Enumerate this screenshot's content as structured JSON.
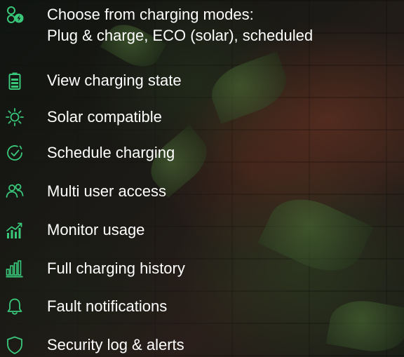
{
  "features": [
    {
      "icon": "charging-modes-icon",
      "label": "Choose from charging modes:",
      "sublabel": "Plug & charge, ECO (solar), scheduled"
    },
    {
      "icon": "battery-icon",
      "label": "View charging state"
    },
    {
      "icon": "sun-icon",
      "label": "Solar compatible"
    },
    {
      "icon": "clock-check-icon",
      "label": "Schedule charging"
    },
    {
      "icon": "users-icon",
      "label": "Multi user access"
    },
    {
      "icon": "chart-trend-icon",
      "label": "Monitor usage"
    },
    {
      "icon": "bar-chart-icon",
      "label": "Full charging history"
    },
    {
      "icon": "bell-icon",
      "label": "Fault notifications"
    },
    {
      "icon": "shield-icon",
      "label": "Security log & alerts"
    }
  ],
  "colors": {
    "accent": "#39C77A",
    "text": "#FFFFFF"
  }
}
